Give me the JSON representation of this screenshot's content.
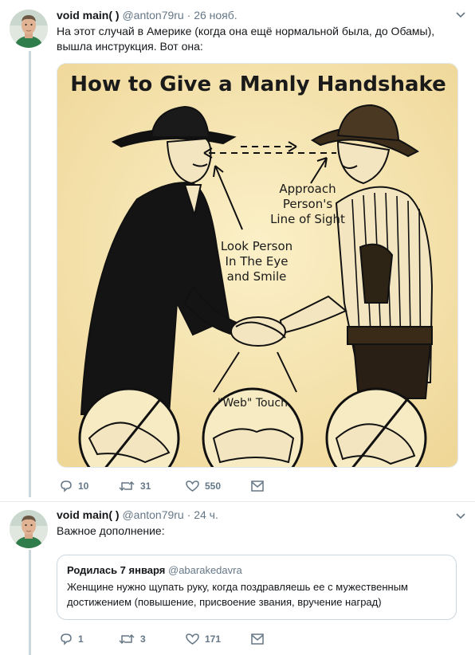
{
  "tweets": [
    {
      "name": "void main( )",
      "handle": "@anton79ru",
      "dot": "·",
      "time": "26 нояб.",
      "text": "На этот случай в Америке (когда она ещё нормальной была, до Обамы), вышла инструкция. Вот она:",
      "media": {
        "title": "How to Give a Manly Handshake",
        "label_approach": [
          "Approach",
          "Person's",
          "Line of Sight"
        ],
        "label_look": [
          "Look Person",
          "In The Eye",
          "and Smile"
        ],
        "label_web": "\"Web\" Touch"
      },
      "actions": {
        "replies": "10",
        "retweets": "31",
        "likes": "550"
      }
    },
    {
      "name": "void main( )",
      "handle": "@anton79ru",
      "dot": "·",
      "time": "24 ч.",
      "text": "Важное дополнение:",
      "quote": {
        "name": "Родилась 7 января",
        "handle": "@abarakedavra",
        "text": "Женщине нужно щупать руку, когда поздравляешь ее с мужественным достижением (повышение, присвоение звания, вручение наград)"
      },
      "actions": {
        "replies": "1",
        "retweets": "3",
        "likes": "171"
      }
    }
  ],
  "icons": {
    "reply": "reply-icon",
    "retweet": "retweet-icon",
    "like": "heart-icon",
    "dm": "envelope-icon",
    "caret": "chevron-down-icon"
  },
  "colors": {
    "secondary_text": "#657786",
    "thread_line": "#ccd6dd",
    "primary_text": "#14171a"
  }
}
